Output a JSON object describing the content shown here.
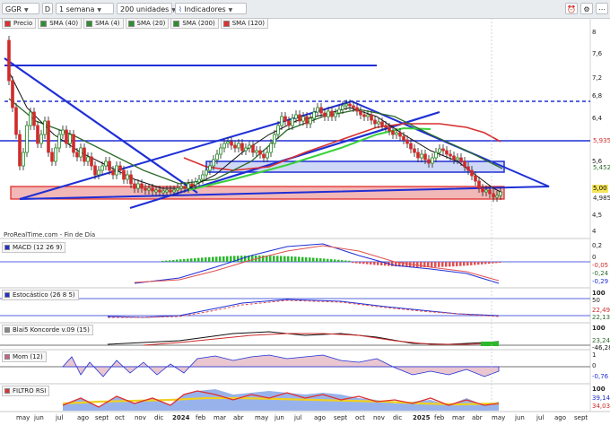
{
  "toolbar": {
    "symbol": "GGR",
    "timeframe": "1 semana",
    "units": "200 unidades",
    "indicators_button": "Indicadores",
    "d_button": "D"
  },
  "legend": [
    {
      "label": "Precio",
      "color": "#e03030"
    },
    {
      "label": "SMA (40)",
      "color": "#2d8f2d"
    },
    {
      "label": "SMA (4)",
      "color": "#111111"
    },
    {
      "label": "SMA (20)",
      "color": "#2d8f2d"
    },
    {
      "label": "SMA (200)",
      "color": "#2d8f2d"
    },
    {
      "label": "SMA (120)",
      "color": "#e03030"
    }
  ],
  "watermark": "ProRealTime.com - Fin de Día",
  "price_axis": [
    "8",
    "7,6",
    "7,2",
    "6,8",
    "6,4",
    "6",
    "5,6",
    "5",
    "4,5",
    "4"
  ],
  "price_tags": {
    "upper": "5,935",
    "mid": "5,452",
    "last": "5,00",
    "low": "4,985"
  },
  "indicators": {
    "macd": {
      "label": "MACD (12 26 9)",
      "ticks": [
        "0,2",
        "0"
      ],
      "values": [
        "-0,05",
        "-0,24",
        "-0,29"
      ]
    },
    "stoch": {
      "label": "Estocástico (26 8 5)",
      "ticks": [
        "100",
        "50",
        "0"
      ],
      "values": [
        "100",
        "22,49",
        "22,13"
      ]
    },
    "blai": {
      "label": "Blai5 Koncorde v.09 (15)",
      "ticks": [
        "100"
      ],
      "values": [
        "23,24",
        "-46,28"
      ]
    },
    "mom": {
      "label": "Mom (12)",
      "ticks": [
        "1",
        "0",
        "-1"
      ],
      "values": [
        "-0,76"
      ]
    },
    "rsi": {
      "label": "FILTRO RSI",
      "ticks": [
        "100"
      ],
      "values": [
        "39,14",
        "34,03"
      ]
    }
  },
  "x_axis": [
    {
      "label": "may",
      "bold": false
    },
    {
      "label": "jun",
      "bold": false
    },
    {
      "label": "jul",
      "bold": false
    },
    {
      "label": "ago",
      "bold": false
    },
    {
      "label": "sept",
      "bold": false
    },
    {
      "label": "oct",
      "bold": false
    },
    {
      "label": "nov",
      "bold": false
    },
    {
      "label": "dic",
      "bold": false
    },
    {
      "label": "2024",
      "bold": true
    },
    {
      "label": "feb",
      "bold": false
    },
    {
      "label": "mar",
      "bold": false
    },
    {
      "label": "abr",
      "bold": false
    },
    {
      "label": "may",
      "bold": false
    },
    {
      "label": "jun",
      "bold": false
    },
    {
      "label": "jul",
      "bold": false
    },
    {
      "label": "ago",
      "bold": false
    },
    {
      "label": "sept",
      "bold": false
    },
    {
      "label": "oct",
      "bold": false
    },
    {
      "label": "nov",
      "bold": false
    },
    {
      "label": "dic",
      "bold": false
    },
    {
      "label": "2025",
      "bold": true
    },
    {
      "label": "feb",
      "bold": false
    },
    {
      "label": "mar",
      "bold": false
    },
    {
      "label": "abr",
      "bold": false
    },
    {
      "label": "may",
      "bold": false
    },
    {
      "label": "jun",
      "bold": false
    },
    {
      "label": "jul",
      "bold": false
    },
    {
      "label": "ago",
      "bold": false
    },
    {
      "label": "sept",
      "bold": false
    }
  ],
  "colors": {
    "up_candle": "#1b8a1b",
    "down_candle": "#d02a2a",
    "trendline": "#1e2fd6",
    "support_zone": "#f2b7b7",
    "blue_zone": "#cfd8f7"
  }
}
